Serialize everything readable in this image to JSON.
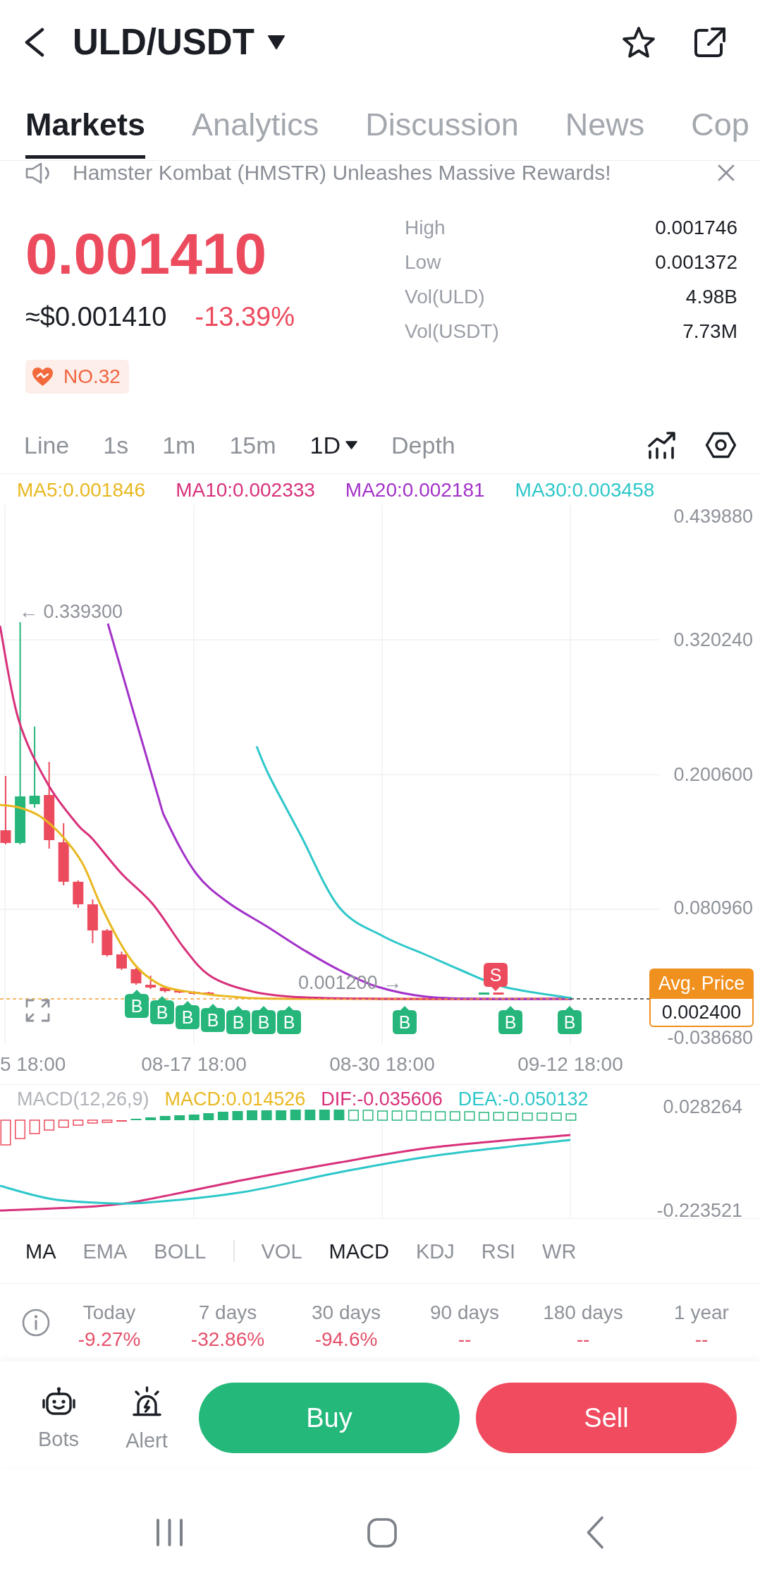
{
  "header": {
    "title": "ULD/USDT"
  },
  "tabs": [
    {
      "label": "Markets",
      "selected": true
    },
    {
      "label": "Analytics",
      "selected": false
    },
    {
      "label": "Discussion",
      "selected": false
    },
    {
      "label": "News",
      "selected": false
    },
    {
      "label": "Cop",
      "selected": false
    }
  ],
  "announcement": {
    "text": "Hamster Kombat (HMSTR) Unleashes Massive Rewards!"
  },
  "ticker": {
    "price": "0.001410",
    "usd_price": "≈$0.001410",
    "change": "-13.39%",
    "rank": "NO.32",
    "stats": [
      {
        "label": "High",
        "value": "0.001746"
      },
      {
        "label": "Low",
        "value": "0.001372"
      },
      {
        "label": "Vol(ULD)",
        "value": "4.98B"
      },
      {
        "label": "Vol(USDT)",
        "value": "7.73M"
      }
    ]
  },
  "intervals": [
    {
      "label": "Line",
      "kind": "option",
      "selected": false
    },
    {
      "label": "1s",
      "kind": "option",
      "selected": false
    },
    {
      "label": "1m",
      "kind": "option",
      "selected": false
    },
    {
      "label": "15m",
      "kind": "option",
      "selected": false
    },
    {
      "label": "1D",
      "kind": "dropdown",
      "selected": true
    },
    {
      "label": "Depth",
      "kind": "option",
      "selected": false
    }
  ],
  "main_chart": {
    "moving_averages": [
      {
        "label": "MA5:0.001846",
        "color": "#e9b820"
      },
      {
        "label": "MA10:0.002333",
        "color": "#d8317b"
      },
      {
        "label": "MA20:0.002181",
        "color": "#a332c8"
      },
      {
        "label": "MA30:0.003458",
        "color": "#2ec7c9"
      }
    ],
    "y_axis_labels": [
      "0.439880",
      "0.320240",
      "0.200600",
      "0.080960",
      "-0.038680"
    ],
    "high_label": "← 0.339300",
    "level_label": "0.001200 →",
    "trade_markers": [
      {
        "label": "B",
        "kind": "buy"
      },
      {
        "label": "B",
        "kind": "buy"
      },
      {
        "label": "B",
        "kind": "buy"
      },
      {
        "label": "B",
        "kind": "buy"
      },
      {
        "label": "B",
        "kind": "buy"
      },
      {
        "label": "B",
        "kind": "buy"
      },
      {
        "label": "B",
        "kind": "buy"
      },
      {
        "label": "B",
        "kind": "buy"
      },
      {
        "label": "S",
        "kind": "sell"
      },
      {
        "label": "B",
        "kind": "buy"
      },
      {
        "label": "B",
        "kind": "buy"
      }
    ],
    "avg_price": {
      "label": "Avg. Price",
      "value": "0.002400"
    },
    "x_axis_labels": [
      "5 18:00",
      "08-17 18:00",
      "08-30 18:00",
      "09-12 18:00"
    ]
  },
  "macd": {
    "title": "MACD(12,26,9)",
    "values": [
      {
        "label": "MACD:0.014526",
        "color": "#e9b820"
      },
      {
        "label": "DIF:-0.035606",
        "color": "#d8317b"
      },
      {
        "label": "DEA:-0.050132",
        "color": "#2ec7c9"
      }
    ],
    "y_axis_labels": [
      "0.028264",
      "-0.223521"
    ]
  },
  "indicator_tabs": {
    "main": [
      {
        "label": "MA",
        "selected": true
      },
      {
        "label": "EMA",
        "selected": false
      },
      {
        "label": "BOLL",
        "selected": false
      }
    ],
    "sub": [
      {
        "label": "VOL",
        "selected": false
      },
      {
        "label": "MACD",
        "selected": true
      },
      {
        "label": "KDJ",
        "selected": false
      },
      {
        "label": "RSI",
        "selected": false
      },
      {
        "label": "WR",
        "selected": false
      }
    ]
  },
  "performance": [
    {
      "label": "Today",
      "value": "-9.27%"
    },
    {
      "label": "7 days",
      "value": "-32.86%"
    },
    {
      "label": "30 days",
      "value": "-94.6%"
    },
    {
      "label": "90 days",
      "value": "--"
    },
    {
      "label": "180 days",
      "value": "--"
    },
    {
      "label": "1 year",
      "value": "--"
    }
  ],
  "tools": [
    {
      "label": "Bots",
      "kind": "bots"
    },
    {
      "label": "Alert",
      "kind": "alert"
    }
  ],
  "actions": [
    {
      "label": "Buy",
      "kind": "buy"
    },
    {
      "label": "Sell",
      "kind": "sell"
    }
  ]
}
